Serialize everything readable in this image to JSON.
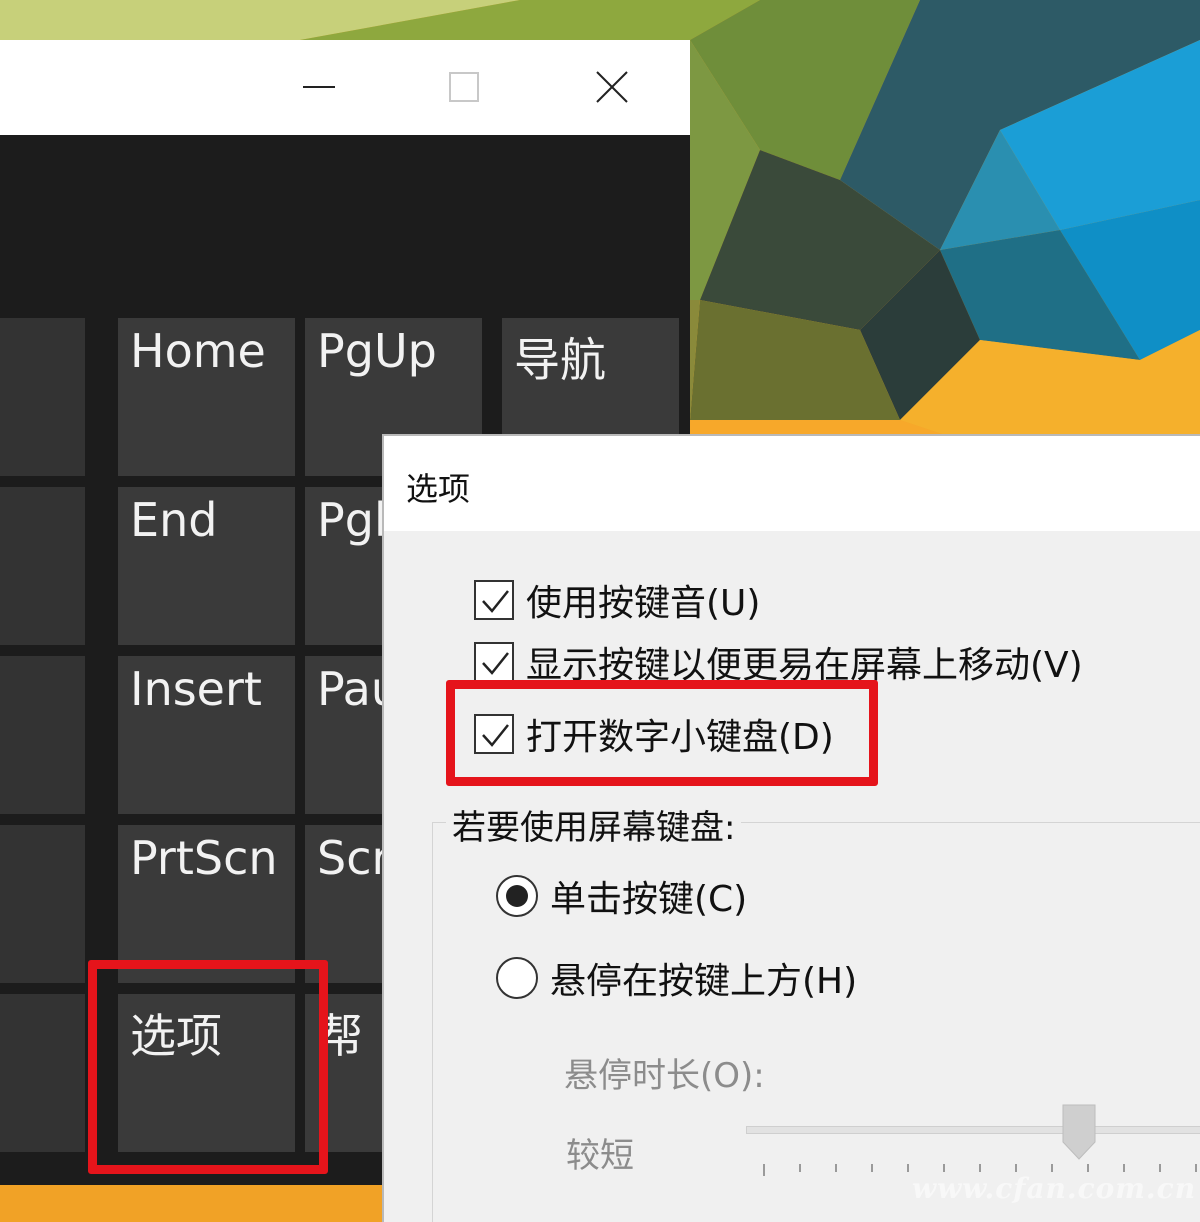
{
  "osk": {
    "titlebar": {
      "minimize_glyph": "—",
      "close_glyph": "✕"
    },
    "keys": {
      "home": "Home",
      "pgup": "PgUp",
      "nav": "导航",
      "end": "End",
      "pgdn_partial": "Pgl",
      "insert": "Insert",
      "pause_partial": "Pau",
      "prtscn": "PrtScn",
      "scrlk_partial": "Scr",
      "options": "选项",
      "help_partial": "帮"
    }
  },
  "dialog": {
    "title": "选项",
    "checkboxes": [
      {
        "label": "使用按键音(U)",
        "checked": true
      },
      {
        "label": "显示按键以便更易在屏幕上移动(V)",
        "checked": true
      },
      {
        "label": "打开数字小键盘(D)",
        "checked": true
      }
    ],
    "group_label": "若要使用屏幕键盘:",
    "radios": [
      {
        "label": "单击按键(C)",
        "selected": true
      },
      {
        "label": "悬停在按键上方(H)",
        "selected": false
      }
    ],
    "hover_duration_label": "悬停时长(O):",
    "slider_min_label": "较短",
    "slider_level": 0.72
  },
  "annotations": {
    "color": "#e5141b"
  },
  "watermark": "www.cfan.com.cn",
  "colors": {
    "key_bg": "#3a3a3a",
    "window_bg": "#1c1c1c",
    "dialog_bg": "#f0f0f0"
  }
}
